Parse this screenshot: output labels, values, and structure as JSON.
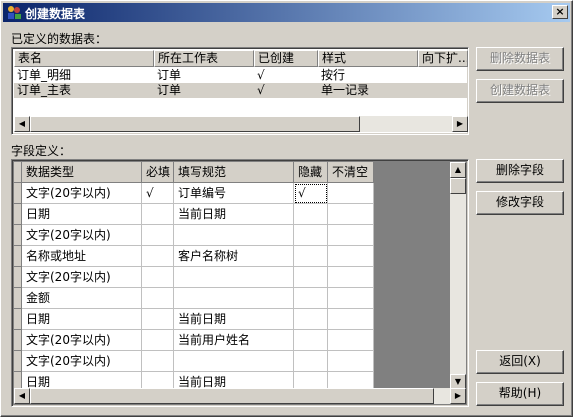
{
  "window": {
    "title": "创建数据表",
    "close_glyph": "×"
  },
  "defined_tables": {
    "label": "已定义的数据表：",
    "columns": [
      "表名",
      "所在工作表",
      "已创建",
      "样式",
      "向下扩..."
    ],
    "rows": [
      {
        "name": "订单_明细",
        "sheet": "订单",
        "created": "√",
        "style": "按行",
        "expand": ""
      },
      {
        "name": "订单_主表",
        "sheet": "订单",
        "created": "√",
        "style": "单一记录",
        "expand": ""
      }
    ],
    "selected_row": 1
  },
  "table_buttons": {
    "delete": "删除数据表",
    "create": "创建数据表"
  },
  "fields": {
    "label": "字段定义：",
    "columns": [
      "数据类型",
      "必填",
      "填写规范",
      "隐藏",
      "不清空"
    ],
    "rows": [
      {
        "type": "文字(20字以内)",
        "required": "√",
        "rule": "订单编号",
        "hidden": "√",
        "keep": ""
      },
      {
        "type": "日期",
        "required": "",
        "rule": "当前日期",
        "hidden": "",
        "keep": ""
      },
      {
        "type": "文字(20字以内)",
        "required": "",
        "rule": "",
        "hidden": "",
        "keep": ""
      },
      {
        "type": "名称或地址",
        "required": "",
        "rule": "客户名称树",
        "hidden": "",
        "keep": ""
      },
      {
        "type": "文字(20字以内)",
        "required": "",
        "rule": "",
        "hidden": "",
        "keep": ""
      },
      {
        "type": "金额",
        "required": "",
        "rule": "",
        "hidden": "",
        "keep": ""
      },
      {
        "type": "日期",
        "required": "",
        "rule": "当前日期",
        "hidden": "",
        "keep": ""
      },
      {
        "type": "文字(20字以内)",
        "required": "",
        "rule": "当前用户姓名",
        "hidden": "",
        "keep": ""
      },
      {
        "type": "文字(20字以内)",
        "required": "",
        "rule": "",
        "hidden": "",
        "keep": ""
      },
      {
        "type": "日期",
        "required": "",
        "rule": "当前日期",
        "hidden": "",
        "keep": ""
      }
    ]
  },
  "field_buttons": {
    "delete": "删除字段",
    "modify": "修改字段"
  },
  "bottom_buttons": {
    "back": "返回(X)",
    "help": "帮助(H)"
  },
  "scroll_glyphs": {
    "left": "◀",
    "right": "▶",
    "up": "▲",
    "down": "▼"
  },
  "colors": {
    "face": "#d4d0c8",
    "title_start": "#0a246a",
    "title_end": "#a6caf0",
    "grid_empty": "#808080"
  }
}
